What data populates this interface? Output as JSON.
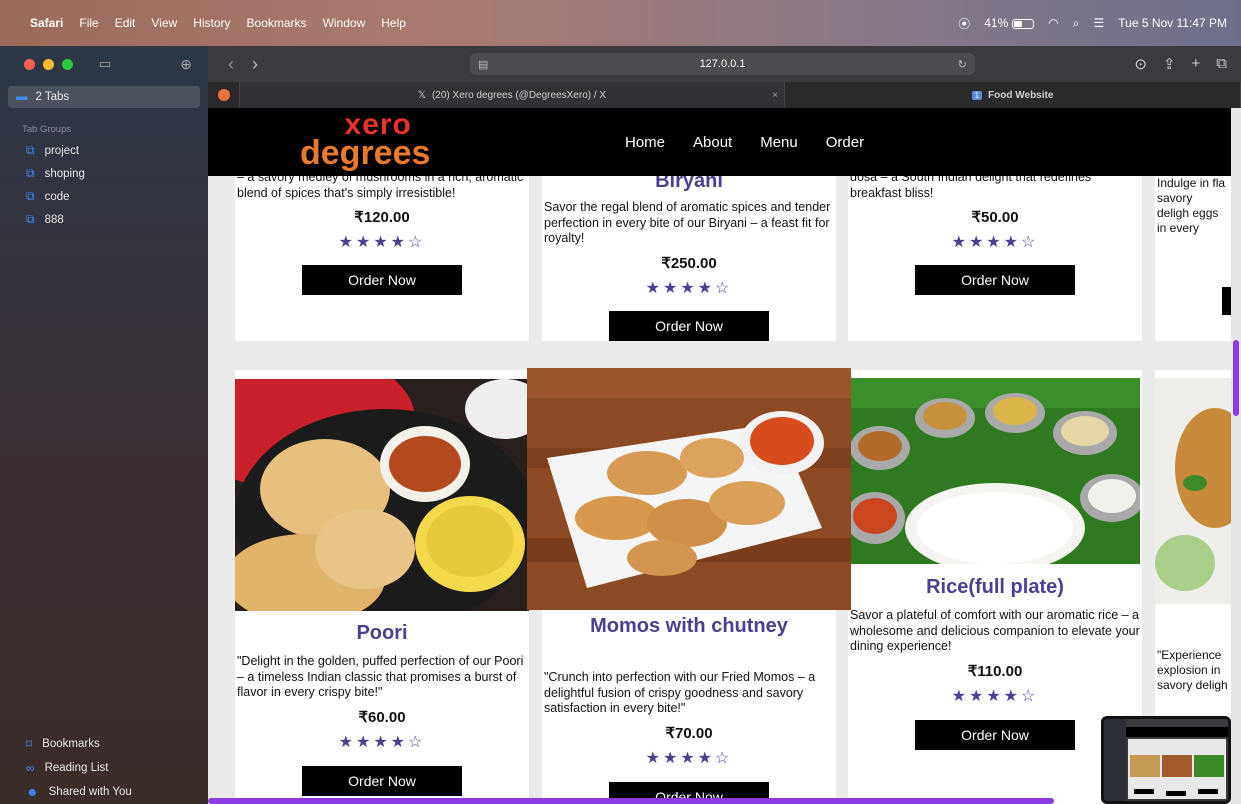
{
  "menubar": {
    "items": [
      "Safari",
      "File",
      "Edit",
      "View",
      "History",
      "Bookmarks",
      "Window",
      "Help"
    ],
    "battery": "41%",
    "datetime": "Tue 5 Nov  11:47 PM"
  },
  "sidebar": {
    "tabs_label": "2 Tabs",
    "groups_heading": "Tab Groups",
    "groups": [
      "project",
      "shoping",
      "code",
      "888"
    ],
    "bottom": [
      "Bookmarks",
      "Reading List",
      "Shared with You"
    ]
  },
  "toolbar": {
    "url": "127.0.0.1"
  },
  "tabs": {
    "x_tab": "(20) Xero degrees (@DegreesXero) / X",
    "food_tab": "Food Website",
    "food_tab_num": "1"
  },
  "site": {
    "logo_top": "xero",
    "logo_bottom": "degrees",
    "nav": [
      "Home",
      "About",
      "Menu",
      "Order"
    ]
  },
  "cards": {
    "mushroom": {
      "desc_partial": "– a savory medley of mushrooms in a rich, aromatic blend of spices that's simply irresistible!",
      "price": "₹120.00",
      "stars": "★★★★☆",
      "button": "Order Now"
    },
    "biryani": {
      "title": "Biryani",
      "desc": "Savor the regal blend of aromatic spices and tender perfection in every bite of our Biryani – a feast fit for royalty!",
      "price": "₹250.00",
      "stars": "★★★★☆",
      "button": "Order Now"
    },
    "dosa": {
      "desc_partial": "dosa – a South Indian delight that redefines breakfast bliss!",
      "price": "₹50.00",
      "stars": "★★★★☆",
      "button": "Order Now"
    },
    "egg": {
      "desc_partial": "Indulge in fla savory deligh eggs in every"
    },
    "poori": {
      "title": "Poori",
      "desc": "\"Delight in the golden, puffed perfection of our Poori – a timeless Indian classic that promises a burst of flavor in every crispy bite!\"",
      "price": "₹60.00",
      "stars": "★★★★☆",
      "button": "Order Now"
    },
    "momos": {
      "title": "Momos with chutney",
      "desc": "\"Crunch into perfection with our Fried Momos – a delightful fusion of crispy goodness and savory satisfaction in every bite!\"",
      "price": "₹70.00",
      "stars": "★★★★☆",
      "button": "Order Now"
    },
    "rice": {
      "title": "Rice(full plate)",
      "desc": "Savor a plateful of comfort with our aromatic rice – a wholesome and delicious companion to elevate your dining experience!",
      "price": "₹110.00",
      "stars": "★★★★☆",
      "button": "Order Now"
    },
    "samosa": {
      "desc_partial": "\"Experience explosion in savory deligh"
    }
  }
}
